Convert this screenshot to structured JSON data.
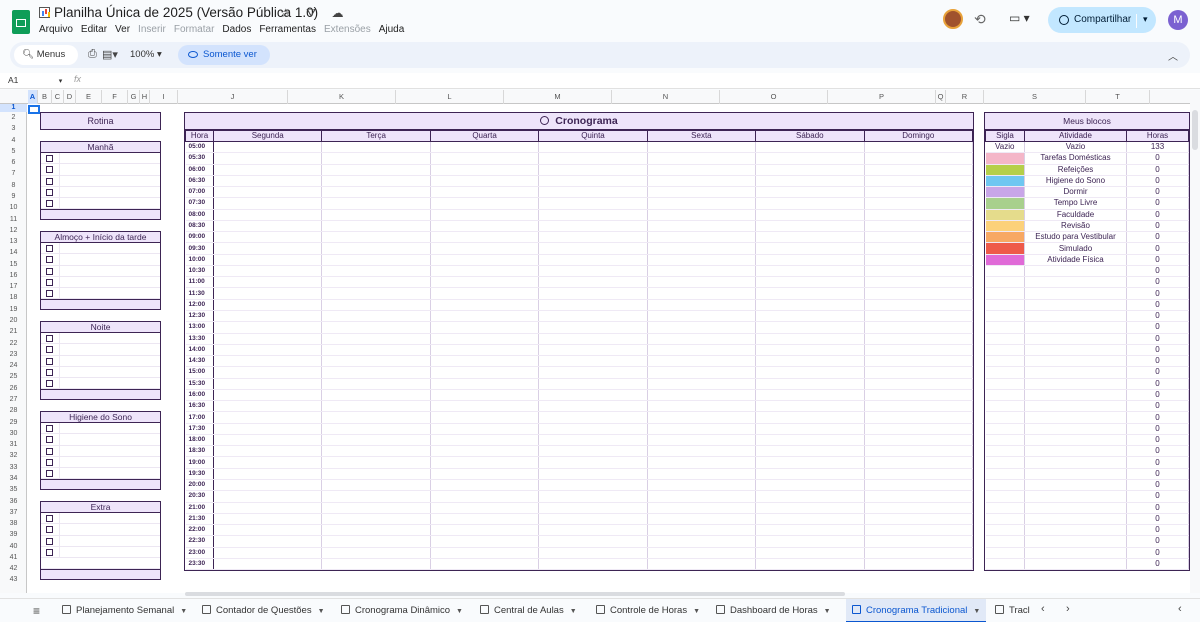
{
  "doc": {
    "title": "Planilha Única de 2025 (Versão Pública 1.0)",
    "title_icons": "☆ ⛛ ☁",
    "menu": [
      {
        "label": "Arquivo",
        "enabled": true
      },
      {
        "label": "Editar",
        "enabled": true
      },
      {
        "label": "Ver",
        "enabled": true
      },
      {
        "label": "Inserir",
        "enabled": false
      },
      {
        "label": "Formatar",
        "enabled": false
      },
      {
        "label": "Dados",
        "enabled": true
      },
      {
        "label": "Ferramentas",
        "enabled": true
      },
      {
        "label": "Extensões",
        "enabled": false
      },
      {
        "label": "Ajuda",
        "enabled": true
      }
    ],
    "share_label": "Compartilhar",
    "user_initial": "M"
  },
  "toolbar": {
    "menus_label": "Menus",
    "zoom": "100%",
    "view_only_label": "Somente ver"
  },
  "formula_bar": {
    "cell_ref": "A1",
    "fx": "fx"
  },
  "columns": [
    "A",
    "B",
    "C",
    "D",
    "E",
    "F",
    "G",
    "H",
    "I",
    "J",
    "K",
    "L",
    "M",
    "N",
    "O",
    "P",
    "Q",
    "R",
    "S",
    "T"
  ],
  "rows": [
    "1",
    "2",
    "3",
    "4",
    "5",
    "6",
    "7",
    "8",
    "9",
    "10",
    "11",
    "12",
    "13",
    "14",
    "15",
    "16",
    "17",
    "18",
    "19",
    "20",
    "21",
    "22",
    "23",
    "24",
    "25",
    "26",
    "27",
    "28",
    "29",
    "30",
    "31",
    "32",
    "33",
    "34",
    "35",
    "36",
    "37",
    "38",
    "39",
    "40",
    "41",
    "42",
    "43"
  ],
  "rotina": {
    "title": "Rotina",
    "sections": [
      {
        "name": "Manhã",
        "count": 5
      },
      {
        "name": "Almoço + Início da tarde",
        "count": 5
      },
      {
        "name": "Noite",
        "count": 5
      },
      {
        "name": "Higiene do Sono",
        "count": 5
      },
      {
        "name": "Extra",
        "count": 4
      }
    ]
  },
  "cronograma": {
    "title": "Cronograma",
    "hour_header": "Hora",
    "days": [
      "Segunda",
      "Terça",
      "Quarta",
      "Quinta",
      "Sexta",
      "Sábado",
      "Domingo"
    ],
    "hours": [
      "05:00",
      "05:30",
      "06:00",
      "06:30",
      "07:00",
      "07:30",
      "08:00",
      "08:30",
      "09:00",
      "09:30",
      "10:00",
      "10:30",
      "11:00",
      "11:30",
      "12:00",
      "12:30",
      "13:00",
      "13:30",
      "14:00",
      "14:30",
      "15:00",
      "15:30",
      "16:00",
      "16:30",
      "17:00",
      "17:30",
      "18:00",
      "18:30",
      "19:00",
      "19:30",
      "20:00",
      "20:30",
      "21:00",
      "21:30",
      "22:00",
      "22:30",
      "23:00",
      "23:30"
    ]
  },
  "blocos": {
    "title": "Meus blocos",
    "headers": [
      "Sigla",
      "Atividade",
      "Horas"
    ],
    "items": [
      {
        "sigla": "Vazio",
        "atividade": "Vazio",
        "horas": "133",
        "color": "#ffffff"
      },
      {
        "sigla": "",
        "atividade": "Tarefas Domésticas",
        "horas": "0",
        "color": "#f4b6c8"
      },
      {
        "sigla": "",
        "atividade": "Refeições",
        "horas": "0",
        "color": "#b5cf4a"
      },
      {
        "sigla": "",
        "atividade": "Higiene do Sono",
        "horas": "0",
        "color": "#6fc7f1"
      },
      {
        "sigla": "",
        "atividade": "Dormir",
        "horas": "0",
        "color": "#c8a6e8"
      },
      {
        "sigla": "",
        "atividade": "Tempo Livre",
        "horas": "0",
        "color": "#a8d08d"
      },
      {
        "sigla": "",
        "atividade": "Faculdade",
        "horas": "0",
        "color": "#e5dc8c"
      },
      {
        "sigla": "",
        "atividade": "Revisão",
        "horas": "0",
        "color": "#fcd17a"
      },
      {
        "sigla": "",
        "atividade": "Estudo para Vestibular",
        "horas": "0",
        "color": "#f7a863"
      },
      {
        "sigla": "",
        "atividade": "Simulado",
        "horas": "0",
        "color": "#ee5a4a"
      },
      {
        "sigla": "",
        "atividade": "Atividade Física",
        "horas": "0",
        "color": "#e06ad7"
      }
    ],
    "extra_zero_rows": 27
  },
  "sheet_tabs": [
    {
      "label": "Planejamento Semanal",
      "active": false
    },
    {
      "label": "Contador de Questões",
      "active": false
    },
    {
      "label": "Cronograma Dinâmico",
      "active": false
    },
    {
      "label": "Central de Aulas",
      "active": false
    },
    {
      "label": "Controle de Horas",
      "active": false
    },
    {
      "label": "Dashboard de Horas",
      "active": false
    },
    {
      "label": "Cronograma Tradicional",
      "active": true
    },
    {
      "label": "Tracl",
      "active": false
    }
  ]
}
